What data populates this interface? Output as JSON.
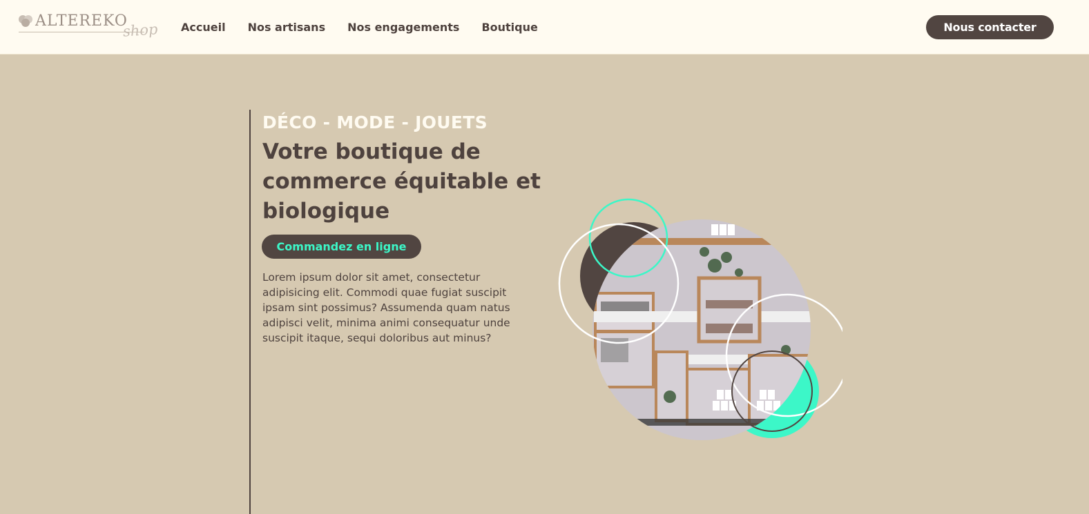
{
  "brand": {
    "name": "ALTEREKO",
    "suffix": "shop"
  },
  "nav": {
    "items": [
      "Accueil",
      "Nos artisans",
      "Nos engagements",
      "Boutique"
    ]
  },
  "header": {
    "contact_label": "Nous contacter"
  },
  "hero": {
    "kicker": "DÉCO - MODE - JOUETS",
    "title": "Votre boutique de commerce équitable et biologique",
    "cta_label": "Commandez en ligne",
    "description": "Lorem ipsum dolor sit amet, consectetur adipisicing elit. Commodi quae fugiat suscipit ipsam sint possimus? Assumenda quam natus adipisci velit, minima animi consequatur unde suscipit itaque, sequi doloribus aut minus?",
    "image": "shop-shelves-photo"
  },
  "colors": {
    "background": "#d6c9b1",
    "header_bg": "#fffbf1",
    "dark": "#514541",
    "accent": "#3cf7c8",
    "light_text": "#fffbf1"
  }
}
